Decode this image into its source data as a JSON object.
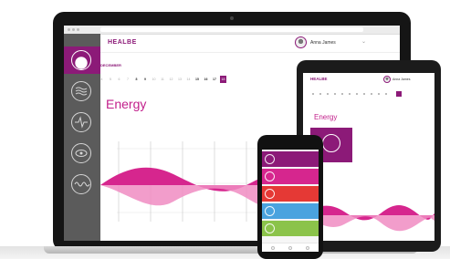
{
  "app": {
    "logo": "HEALBE"
  },
  "user": {
    "name": "Anna James"
  },
  "calendar": {
    "month": "DECEMBER",
    "days": [
      "4",
      "5",
      "6",
      "7",
      "8",
      "9",
      "10",
      "11",
      "12",
      "13",
      "14",
      "15",
      "16",
      "17",
      "18"
    ],
    "dark_days": [
      "8",
      "9",
      "15",
      "16",
      "17"
    ],
    "selected_day": "18"
  },
  "section": {
    "title": "Energy"
  },
  "sidebar": {
    "items": [
      {
        "icon": "energy-icon",
        "active": true
      },
      {
        "icon": "water-balance-icon",
        "active": false
      },
      {
        "icon": "heart-rate-icon",
        "active": false
      },
      {
        "icon": "sleep-icon",
        "active": false
      },
      {
        "icon": "stress-icon",
        "active": false
      }
    ]
  },
  "colors": {
    "brand": "#8c1a78",
    "accent": "#c21f8b",
    "wave_dark": "#d6268e",
    "wave_light": "#f08cc2",
    "phone_cards": [
      "#8c1a78",
      "#d6268e",
      "#e53935",
      "#4aa3df",
      "#8bc34a"
    ]
  }
}
